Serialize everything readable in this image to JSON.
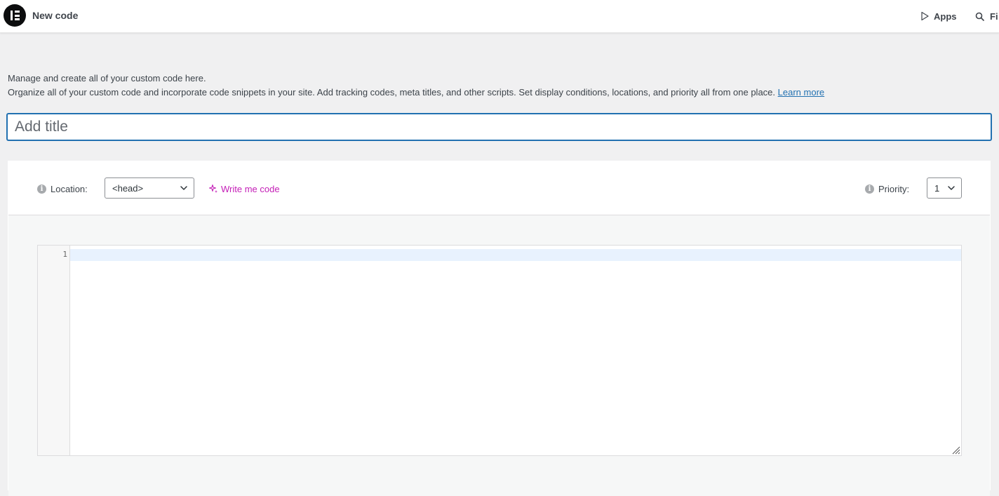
{
  "topbar": {
    "page_title": "New code",
    "apps_label": "Apps",
    "find_label": "Fi"
  },
  "intro": {
    "line1": "Manage and create all of your custom code here.",
    "line2": "Organize all of your custom code and incorporate code snippets in your site. Add tracking codes, meta titles, and other scripts. Set display conditions, locations, and priority all from one place.",
    "learn_more": "Learn more"
  },
  "title_field": {
    "placeholder": "Add title",
    "value": ""
  },
  "settings": {
    "location_label": "Location:",
    "location_value": "<head>",
    "write_code_label": "Write me code",
    "priority_label": "Priority:",
    "priority_value": "1"
  },
  "editor": {
    "line_numbers": [
      "1"
    ]
  },
  "colors": {
    "accent": "#2271b1",
    "ai_magenta": "#c41fb7",
    "active_line": "#e8f2fe"
  }
}
